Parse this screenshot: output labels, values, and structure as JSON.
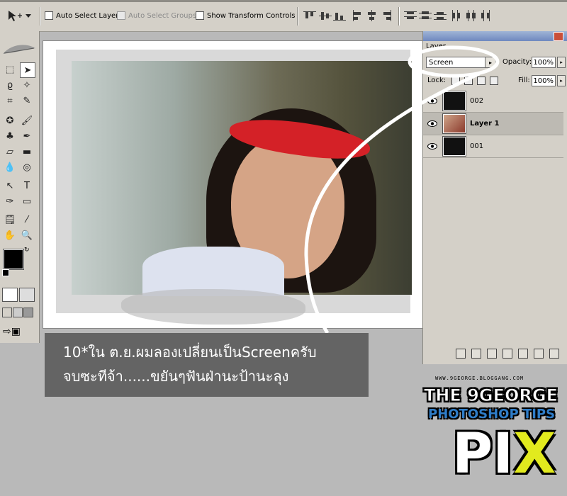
{
  "options_bar": {
    "auto_select_layer": "Auto Select Layer",
    "auto_select_groups": "Auto Select Groups",
    "show_transform_controls": "Show Transform Controls"
  },
  "layers_panel": {
    "tab": "Layer",
    "blend_mode": "Screen",
    "opacity_label": "Opacity:",
    "opacity_value": "100%",
    "lock_label": "Lock:",
    "fill_label": "Fill:",
    "fill_value": "100%",
    "layers": [
      {
        "name": "002",
        "active": false
      },
      {
        "name": "Layer 1",
        "active": true
      },
      {
        "name": "001",
        "active": false
      }
    ]
  },
  "caption": {
    "line1": "10*ใน ต.ย.ผมลองเปลี่ยนเป็นScreenครับ",
    "line2": "จบซะทีจ้า......ขยันๆฟันฝ่านะป้านะลุง"
  },
  "logo": {
    "url": "WWW.9GEORGE.BLOGGANG.COM",
    "line1": "THE 9GEORGE",
    "line2": "PHOTOSHOP TIPS",
    "pix_main": "PI",
    "pix_x": "X"
  },
  "colors": {
    "accent_red": "#d42127",
    "logo_blue": "#2f7dc8",
    "logo_yellow": "#e2ea1e",
    "caption_bg": "#646464"
  }
}
